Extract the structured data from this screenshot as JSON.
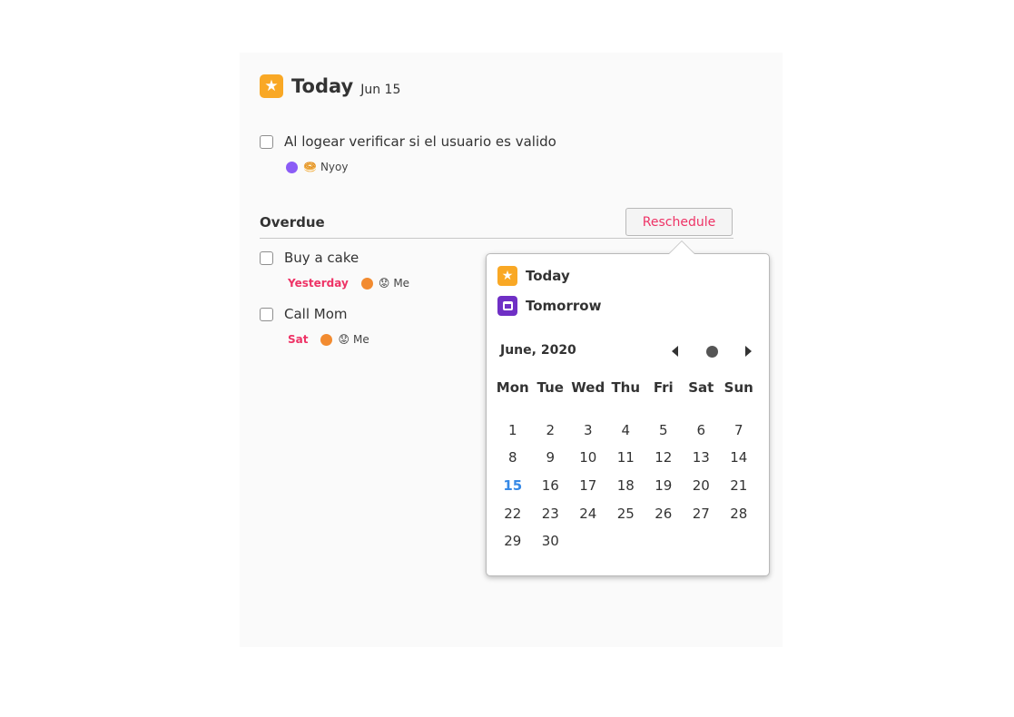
{
  "header": {
    "title": "Today",
    "date": "Jun 15",
    "icon": "star-icon",
    "icon_color": "#f9a825"
  },
  "today_tasks": [
    {
      "label": "Al logear verificar si el usuario es valido",
      "dot_color": "#8b5cf6",
      "emoji": "🥯",
      "assignee": "Nyoy"
    }
  ],
  "overdue": {
    "title": "Overdue",
    "reschedule_label": "Reschedule",
    "tasks": [
      {
        "label": "Buy a cake",
        "due": "Yesterday",
        "dot_color": "#f28b30",
        "emoji": "😟",
        "assignee": "Me"
      },
      {
        "label": "Call Mom",
        "due": "Sat",
        "dot_color": "#f28b30",
        "emoji": "😟",
        "assignee": "Me"
      }
    ]
  },
  "popover": {
    "quick": [
      {
        "label": "Today",
        "icon": "star-icon",
        "color": "#f9a825"
      },
      {
        "label": "Tomorrow",
        "icon": "calendar-icon",
        "color": "#6f2fc5"
      }
    ],
    "calendar": {
      "month_label": "June, 2020",
      "weekdays": [
        "Mon",
        "Tue",
        "Wed",
        "Thu",
        "Fri",
        "Sat",
        "Sun"
      ],
      "weeks": [
        [
          "1",
          "2",
          "3",
          "4",
          "5",
          "6",
          "7"
        ],
        [
          "8",
          "9",
          "10",
          "11",
          "12",
          "13",
          "14"
        ],
        [
          "15",
          "16",
          "17",
          "18",
          "19",
          "20",
          "21"
        ],
        [
          "22",
          "23",
          "24",
          "25",
          "26",
          "27",
          "28"
        ],
        [
          "29",
          "30",
          "",
          "",
          "",
          "",
          ""
        ]
      ],
      "today": "15",
      "today_color": "#3689e6"
    }
  },
  "colors": {
    "accent": "#ee3366",
    "panel_bg": "#fafafa"
  }
}
